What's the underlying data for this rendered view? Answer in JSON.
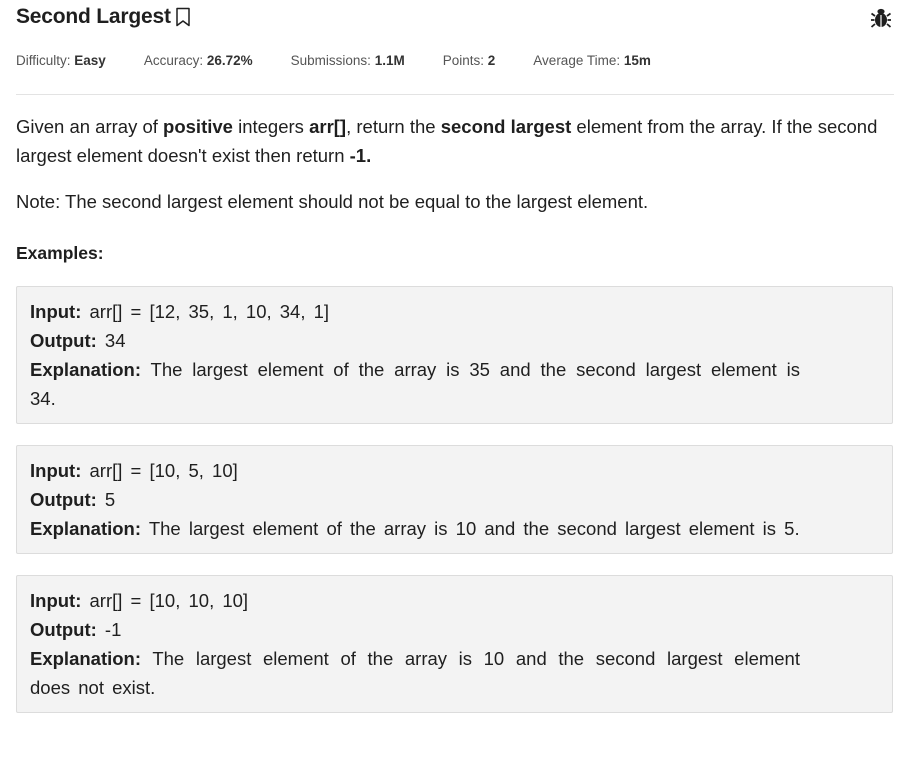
{
  "problem": {
    "title": "Second Largest",
    "meta": {
      "difficulty_label": "Difficulty:",
      "difficulty": "Easy",
      "accuracy_label": "Accuracy:",
      "accuracy": "26.72%",
      "submissions_label": "Submissions:",
      "submissions": "1.1M",
      "points_label": "Points:",
      "points": "2",
      "avg_time_label": "Average Time:",
      "avg_time": "15m"
    },
    "statement": {
      "p1_a": "Given an array of ",
      "p1_b": "positive",
      "p1_c": " integers ",
      "p1_d": "arr[]",
      "p1_e": ", return the ",
      "p1_f": "second largest",
      "p1_g": " element from the array. If the second largest element doesn't exist then return ",
      "p1_h": "-1.",
      "note": "Note: The second largest element should not be equal to the largest element."
    },
    "examples_heading": "Examples:",
    "labels": {
      "input": "Input:",
      "output": "Output:",
      "explanation": "Explanation:"
    },
    "examples": [
      {
        "input": " arr[] = [12, 35, 1, 10, 34, 1]",
        "output": " 34",
        "explanation": " The largest element of the array is 35 and the second largest element is 34."
      },
      {
        "input": " arr[] = [10, 5, 10]",
        "output": " 5",
        "explanation": " The largest element of the array is 10 and the second largest element is 5."
      },
      {
        "input": " arr[] = [10, 10, 10]",
        "output": " -1",
        "explanation": " The largest element of the array is 10 and the second largest element does not exist."
      }
    ]
  },
  "icons": {
    "bookmark": "bookmark-icon",
    "bug": "bug-icon"
  }
}
